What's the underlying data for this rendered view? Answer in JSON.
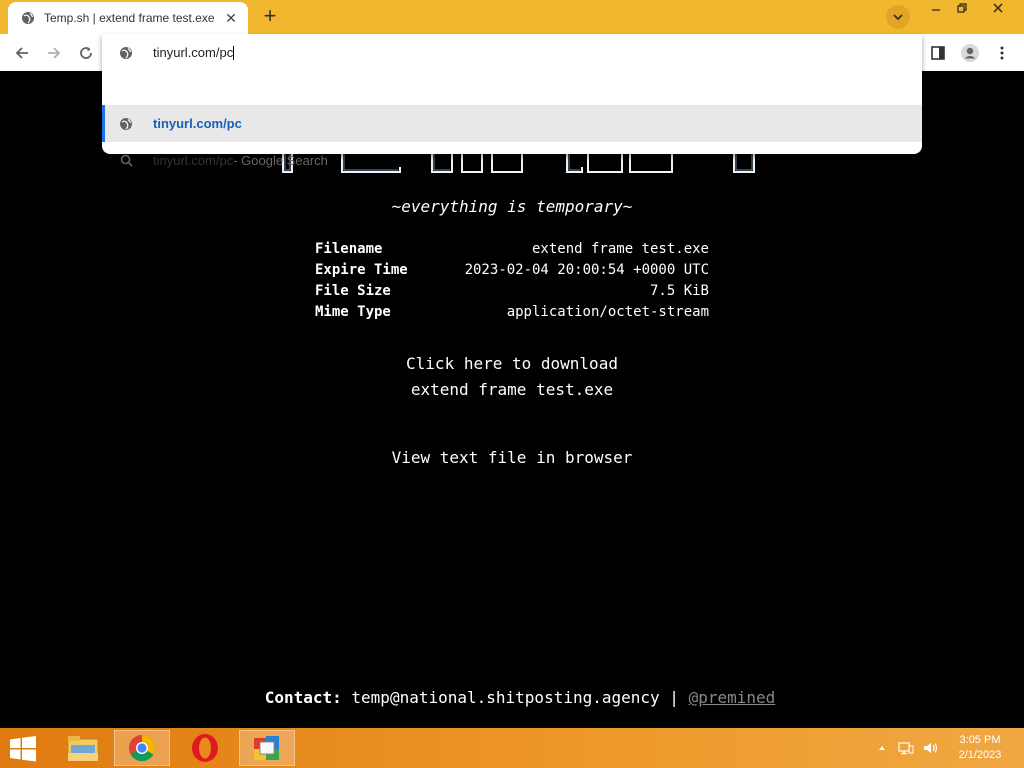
{
  "browser": {
    "tab": {
      "title": "Temp.sh | extend frame test.exe",
      "favicon": "globe-icon",
      "close": "✕"
    },
    "new_tab": "+",
    "address": {
      "value": "tinyurl.com/pc"
    },
    "suggestions": [
      {
        "text": "tinyurl.com/pc",
        "icon": "globe-icon",
        "suffix": ""
      },
      {
        "text": "tinyurl.com/pc",
        "icon": "search-icon",
        "suffix": " - Google Search"
      }
    ]
  },
  "page": {
    "tagline": "~everything is temporary~",
    "info": [
      {
        "label": "Filename",
        "value": "extend frame test.exe"
      },
      {
        "label": "Expire Time",
        "value": "2023-02-04 20:00:54 +0000 UTC"
      },
      {
        "label": "File Size",
        "value": "7.5 KiB"
      },
      {
        "label": "Mime Type",
        "value": "application/octet-stream"
      }
    ],
    "download_line1": "Click here to download",
    "download_line2": "extend frame test.exe",
    "view_text": "View text file in browser",
    "contact_label": "Contact:",
    "contact_email": "temp@national.shitposting.agency",
    "contact_sep": "|",
    "contact_handle": "@premined"
  },
  "taskbar": {
    "time": "3:05 PM",
    "date": "2/1/2023"
  },
  "colors": {
    "tabbar": "#f1b72e",
    "link_blue": "#1a5fb4",
    "taskbar": "#e88a1c"
  }
}
